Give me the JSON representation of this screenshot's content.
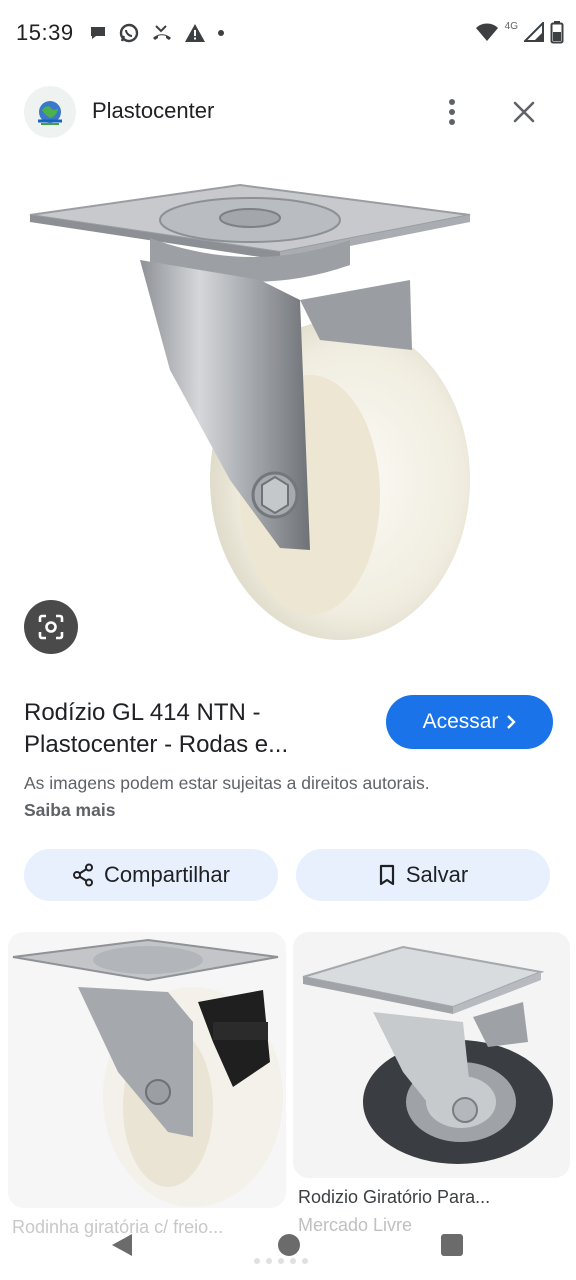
{
  "status_bar": {
    "time": "15:39",
    "network_label": "4G",
    "left_icons": [
      "chat-bubble-icon",
      "whatsapp-icon",
      "missed-call-icon",
      "warning-icon",
      "dot-icon"
    ],
    "right_icons": [
      "wifi-icon",
      "signal-icon",
      "battery-icon"
    ]
  },
  "header": {
    "site_name": "Plastocenter",
    "icons": [
      "site-logo-icon",
      "more-vert-icon",
      "close-icon"
    ]
  },
  "result": {
    "title": "Rodízio GL 414 NTN - Plastocenter - Rodas e...",
    "visit_label": "Acessar",
    "copyright_text": "As imagens podem estar sujeitas a direitos autorais.",
    "learn_more": "Saiba mais",
    "share_label": "Compartilhar",
    "save_label": "Salvar"
  },
  "related": [
    {
      "caption": "Rodinha giratória c/ freio...",
      "source": ""
    },
    {
      "caption": "Rodizio Giratório Para...",
      "source": "Mercado Livre"
    }
  ],
  "colors": {
    "accent": "#1a73e8",
    "button_tint": "#e8f0fe",
    "text_primary": "#202124",
    "text_secondary": "#5f6368"
  }
}
